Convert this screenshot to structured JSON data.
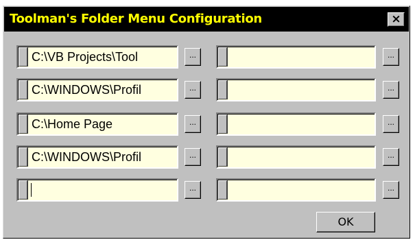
{
  "window": {
    "title": "Toolman's Folder Menu Configuration",
    "close_glyph": "×"
  },
  "rows": [
    {
      "left": "C:\\VB Projects\\Tool",
      "right": ""
    },
    {
      "left": "C:\\WINDOWS\\Profil",
      "right": ""
    },
    {
      "left": "C:\\Home Page",
      "right": ""
    },
    {
      "left": "C:\\WINDOWS\\Profil",
      "right": ""
    },
    {
      "left": "",
      "right": ""
    }
  ],
  "browse_label": "...",
  "ok_label": "OK",
  "colors": {
    "field_bg": "#ffffe0",
    "title_bg": "#000000",
    "title_fg": "#ffff00",
    "dialog_bg": "#c0c0c0"
  }
}
